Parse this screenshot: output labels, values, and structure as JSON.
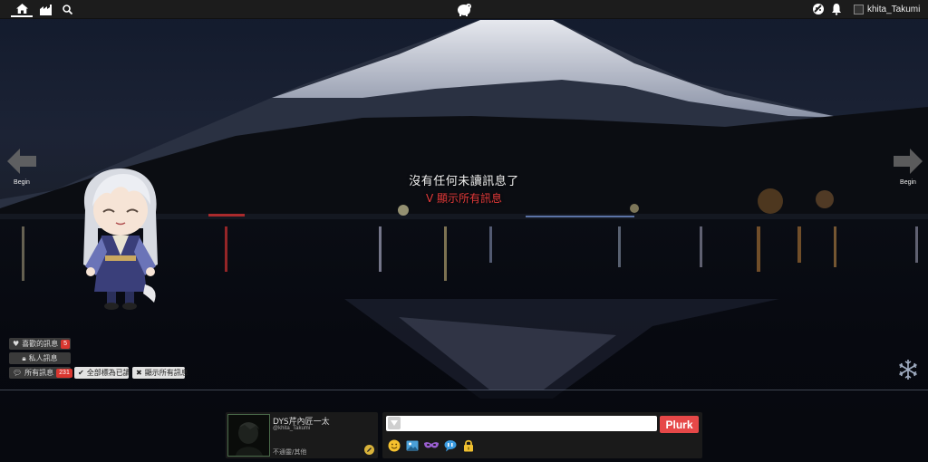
{
  "topbar": {
    "home_icon": "home-icon",
    "stats_icon": "factory-icon",
    "search_icon": "search-icon",
    "logo_icon": "plurk-dino-icon",
    "anon_icon": "anonymous-icon",
    "bell_icon": "bell-icon",
    "username": "khita_Takumi"
  },
  "arrows": {
    "left_label": "Begin",
    "right_label": "Begin"
  },
  "center": {
    "no_unread": "沒有任何未讀訊息了",
    "show_all": "V 顯示所有訊息"
  },
  "filters": {
    "liked": {
      "label": "喜歡的訊息",
      "count": "5"
    },
    "private": {
      "label": "私人訊息"
    },
    "all": {
      "label": "所有訊息",
      "count": "231"
    },
    "mark_read": {
      "label": "全部標為已讀"
    },
    "show_all": {
      "label": "顯示所有訊息"
    }
  },
  "profile": {
    "display_name": "DYS芹內匠一太",
    "handle": "@khita_Takumi",
    "status": "不通靈/其他"
  },
  "compose": {
    "placeholder": "",
    "submit_label": "Plurk"
  },
  "colors": {
    "accent": "#e64848",
    "badge": "#d9362f",
    "topbar": "#1c1c1c",
    "panel": "#1a1a1a"
  }
}
